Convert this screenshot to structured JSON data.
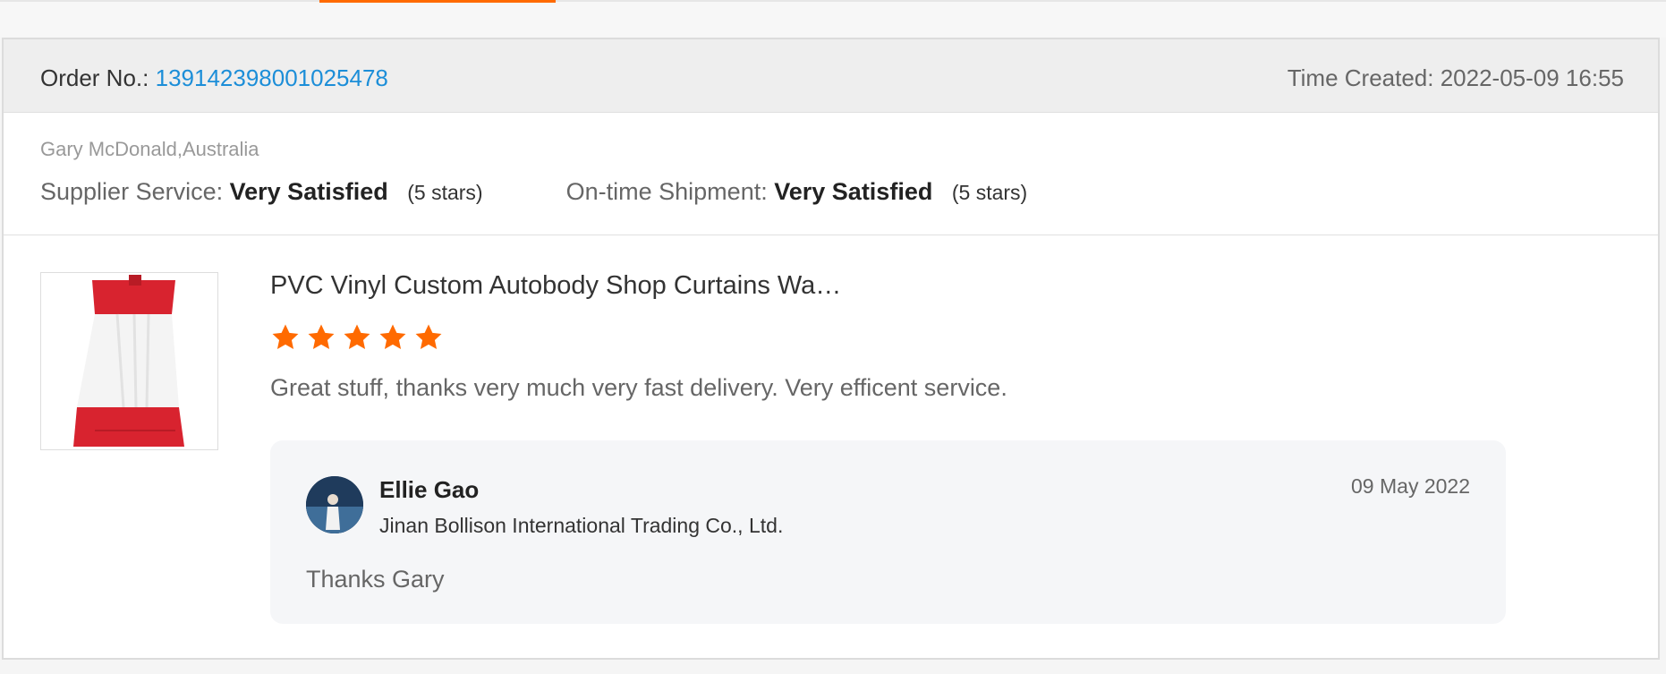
{
  "order": {
    "label": "Order No.:",
    "number": "139142398001025478",
    "time_created": "Time Created: 2022-05-09 16:55"
  },
  "buyer": {
    "name_location": "Gary McDonald,Australia"
  },
  "ratings": {
    "supplier_service_label": "Supplier Service:",
    "supplier_service_value": "Very Satisfied",
    "supplier_service_stars": "(5 stars)",
    "shipment_label": "On-time Shipment:",
    "shipment_value": "Very Satisfied",
    "shipment_stars": "(5 stars)"
  },
  "product": {
    "title": "PVC Vinyl Custom Autobody Shop Curtains Wa…",
    "star_rating": 5,
    "star_color": "#ff6a00",
    "review": "Great stuff, thanks very much very fast delivery.  Very efficent service."
  },
  "reply": {
    "name": "Ellie Gao",
    "company": "Jinan Bollison International Trading Co., Ltd.",
    "date": "09 May 2022",
    "text": "Thanks Gary"
  },
  "colors": {
    "accent": "#ff6a00",
    "link": "#1c8ed8"
  }
}
